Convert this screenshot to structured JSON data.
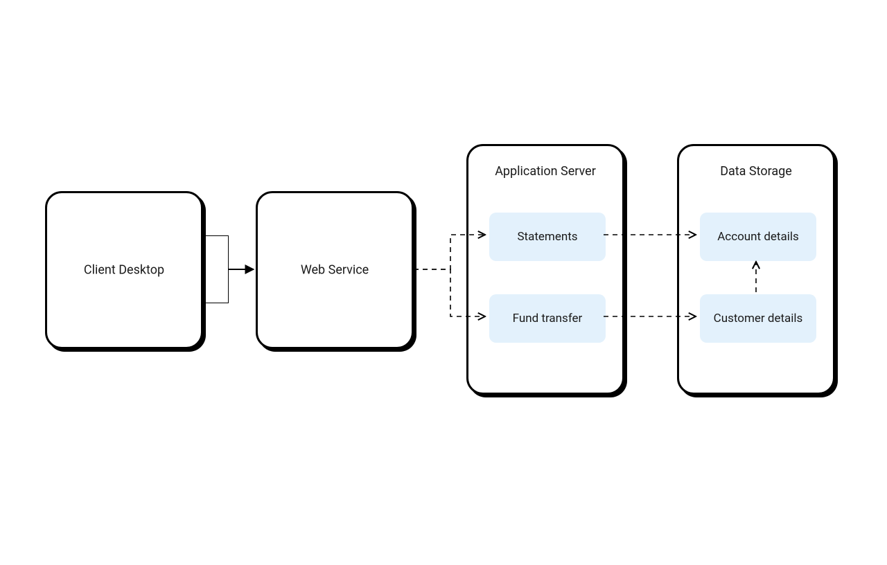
{
  "nodes": {
    "client_desktop": {
      "label": "Client Desktop"
    },
    "web_service": {
      "label": "Web Service"
    },
    "application_server": {
      "label": "Application Server",
      "children": {
        "statements": {
          "label": "Statements"
        },
        "fund_transfer": {
          "label": "Fund transfer"
        }
      }
    },
    "data_storage": {
      "label": "Data Storage",
      "children": {
        "account_details": {
          "label": "Account details"
        },
        "customer_details": {
          "label": "Customer details"
        }
      }
    }
  },
  "edges": [
    {
      "from": "client_desktop",
      "to": "web_service",
      "style": "solid",
      "directed": true
    },
    {
      "from": "web_service",
      "to": "application_server.statements",
      "style": "dashed",
      "directed": true
    },
    {
      "from": "web_service",
      "to": "application_server.fund_transfer",
      "style": "dashed",
      "directed": true
    },
    {
      "from": "application_server.statements",
      "to": "data_storage.account_details",
      "style": "dashed",
      "directed": true
    },
    {
      "from": "application_server.fund_transfer",
      "to": "data_storage.customer_details",
      "style": "dashed",
      "directed": true
    },
    {
      "from": "data_storage.customer_details",
      "to": "data_storage.account_details",
      "style": "dashed",
      "directed": true
    }
  ],
  "colors": {
    "inner_fill": "#e3f1fc",
    "stroke": "#000000",
    "background": "#ffffff"
  }
}
